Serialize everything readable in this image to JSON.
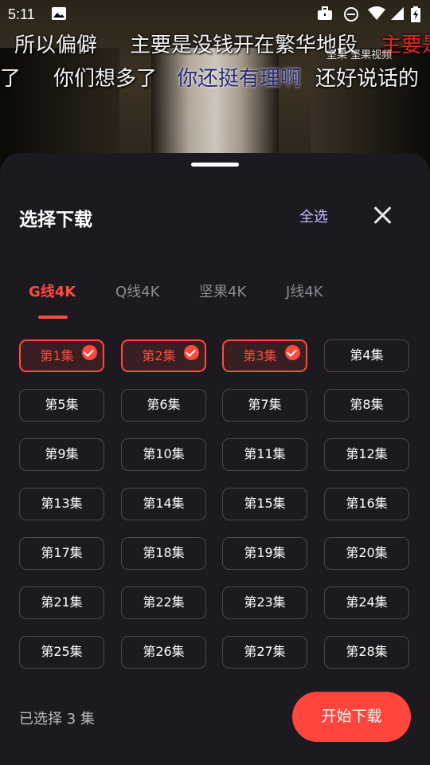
{
  "status_bar": {
    "time": "5:11",
    "icons": [
      "image-icon",
      "briefcase-icon",
      "do-not-disturb-icon",
      "wifi-icon",
      "signal-icon",
      "battery-icon"
    ]
  },
  "video": {
    "danmaku_row1": [
      "所以偏僻",
      "主要是没钱开在繁华地段",
      "主要是"
    ],
    "danmaku_row2": [
      "了",
      "你们想多了",
      "你还挺有理啊",
      "还好说话的"
    ],
    "watermark": "坚果 坚果视频"
  },
  "sheet": {
    "title": "选择下载",
    "select_all": "全选",
    "tabs": [
      {
        "label": "G线4K",
        "active": true
      },
      {
        "label": "Q线4K",
        "active": false
      },
      {
        "label": "坚果4K",
        "active": false
      },
      {
        "label": "J线4K",
        "active": false
      }
    ],
    "episodes": [
      {
        "label": "第1集",
        "selected": true
      },
      {
        "label": "第2集",
        "selected": true
      },
      {
        "label": "第3集",
        "selected": true
      },
      {
        "label": "第4集",
        "selected": false
      },
      {
        "label": "第5集",
        "selected": false
      },
      {
        "label": "第6集",
        "selected": false
      },
      {
        "label": "第7集",
        "selected": false
      },
      {
        "label": "第8集",
        "selected": false
      },
      {
        "label": "第9集",
        "selected": false
      },
      {
        "label": "第10集",
        "selected": false
      },
      {
        "label": "第11集",
        "selected": false
      },
      {
        "label": "第12集",
        "selected": false
      },
      {
        "label": "第13集",
        "selected": false
      },
      {
        "label": "第14集",
        "selected": false
      },
      {
        "label": "第15集",
        "selected": false
      },
      {
        "label": "第16集",
        "selected": false
      },
      {
        "label": "第17集",
        "selected": false
      },
      {
        "label": "第18集",
        "selected": false
      },
      {
        "label": "第19集",
        "selected": false
      },
      {
        "label": "第20集",
        "selected": false
      },
      {
        "label": "第21集",
        "selected": false
      },
      {
        "label": "第22集",
        "selected": false
      },
      {
        "label": "第23集",
        "selected": false
      },
      {
        "label": "第24集",
        "selected": false
      },
      {
        "label": "第25集",
        "selected": false
      },
      {
        "label": "第26集",
        "selected": false
      },
      {
        "label": "第27集",
        "selected": false
      },
      {
        "label": "第28集",
        "selected": false
      }
    ],
    "selected_count_text": "已选择 3 集",
    "download_button": "开始下载",
    "colors": {
      "accent": "#ff4a3d",
      "select_all": "#c9b6ff",
      "sheet_bg": "#1c1a20"
    }
  }
}
